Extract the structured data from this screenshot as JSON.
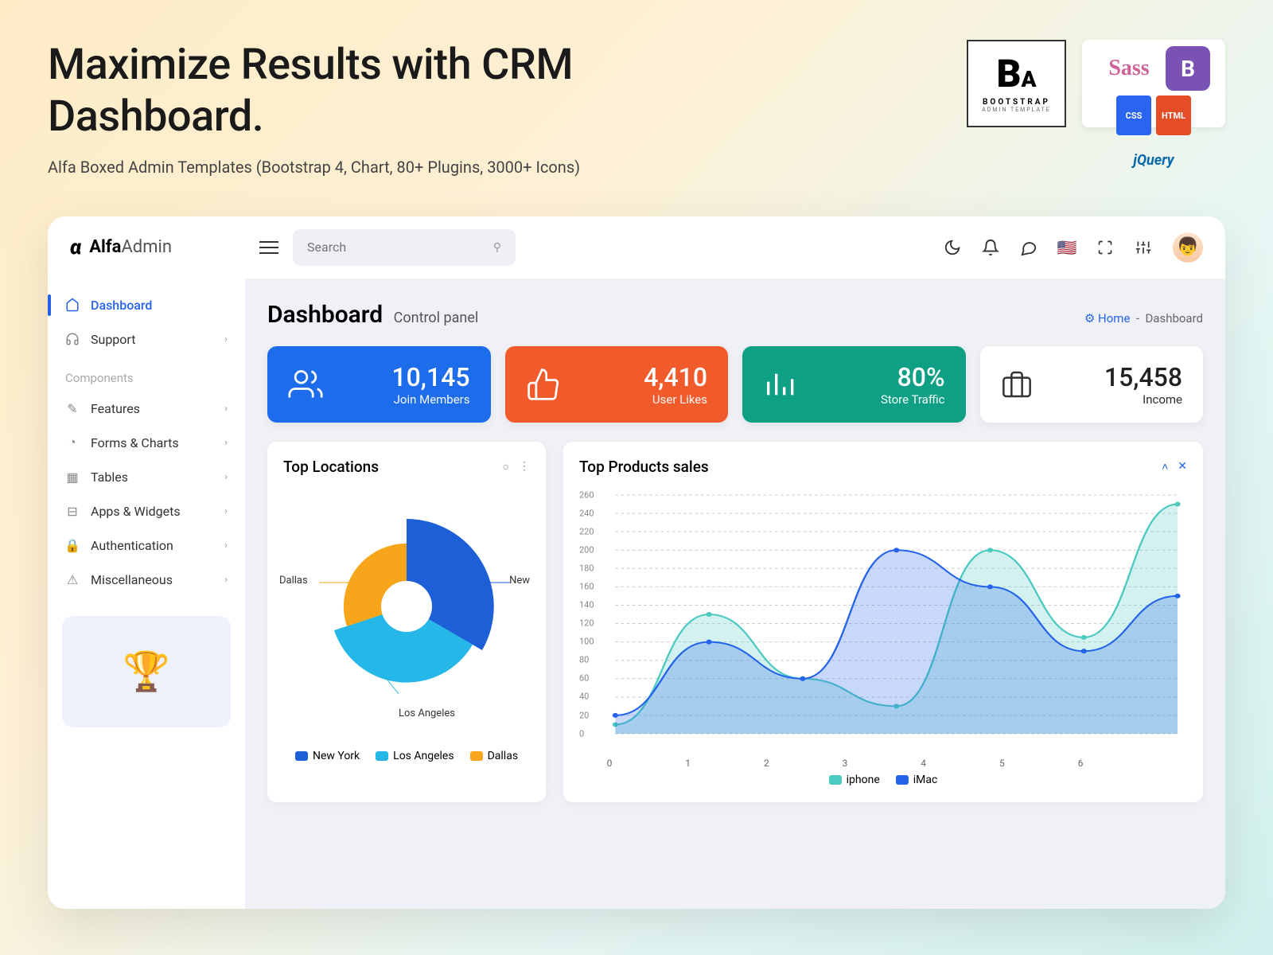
{
  "hero": {
    "title_l1": "Maximize Results with CRM",
    "title_l2": "Dashboard.",
    "subtitle": "Alfa Boxed Admin Templates (Bootstrap 4, Chart, 80+ Plugins, 3000+ Icons)",
    "bootstrap_label": "BOOTSTRAP",
    "bootstrap_sub": "ADMIN TEMPLATE",
    "badges": {
      "sass": "Sass",
      "css3": "CSS",
      "html5": "HTML",
      "bs": "B",
      "jq": "jQuery"
    }
  },
  "app": {
    "logo": {
      "bold": "Alfa",
      "light": "Admin"
    },
    "search_placeholder": "Search"
  },
  "sidebar": {
    "items": [
      {
        "icon": "home",
        "label": "Dashboard",
        "active": true,
        "expand": false
      },
      {
        "icon": "support",
        "label": "Support",
        "expand": true
      }
    ],
    "section": "Components",
    "comp": [
      {
        "icon": "features",
        "label": "Features"
      },
      {
        "icon": "forms",
        "label": "Forms & Charts"
      },
      {
        "icon": "tables",
        "label": "Tables"
      },
      {
        "icon": "apps",
        "label": "Apps & Widgets"
      },
      {
        "icon": "auth",
        "label": "Authentication"
      },
      {
        "icon": "misc",
        "label": "Miscellaneous"
      }
    ]
  },
  "page": {
    "title": "Dashboard",
    "subtitle": "Control panel",
    "crumb_home": "Home",
    "crumb_cur": "Dashboard"
  },
  "stats": [
    {
      "icon": "users",
      "value": "10,145",
      "label": "Join Members",
      "cls": "s-blue"
    },
    {
      "icon": "like",
      "value": "4,410",
      "label": "User Likes",
      "cls": "s-orange"
    },
    {
      "icon": "traffic",
      "value": "80%",
      "label": "Store Traffic",
      "cls": "s-teal"
    },
    {
      "icon": "income",
      "value": "15,458",
      "label": "Income",
      "cls": "s-white"
    }
  ],
  "panels": {
    "locations": {
      "title": "Top Locations",
      "labels": {
        "new": "New",
        "la": "Los Angeles",
        "dallas": "Dallas"
      },
      "legend": [
        {
          "name": "New York",
          "color": "#1d5fd6"
        },
        {
          "name": "Los Angeles",
          "color": "#25b7e8"
        },
        {
          "name": "Dallas",
          "color": "#f7a61b"
        }
      ]
    },
    "products": {
      "title": "Top Products sales",
      "legend": [
        {
          "name": "iphone",
          "color": "#4cc9c0"
        },
        {
          "name": "iMac",
          "color": "#2563eb"
        }
      ]
    }
  },
  "chart_data": [
    {
      "type": "pie",
      "title": "Top Locations",
      "series": [
        {
          "name": "New York",
          "value": 45
        },
        {
          "name": "Los Angeles",
          "value": 35
        },
        {
          "name": "Dallas",
          "value": 20
        }
      ]
    },
    {
      "type": "area",
      "title": "Top Products sales",
      "x": [
        0,
        1,
        2,
        3,
        4,
        5,
        6
      ],
      "xlabel": "",
      "ylabel": "",
      "ylim": [
        0,
        260
      ],
      "yticks": [
        0,
        20,
        40,
        60,
        80,
        100,
        120,
        140,
        160,
        180,
        200,
        220,
        240,
        260
      ],
      "series": [
        {
          "name": "iphone",
          "color": "#4cc9c0",
          "values": [
            10,
            130,
            60,
            30,
            200,
            105,
            250
          ]
        },
        {
          "name": "iMac",
          "color": "#2563eb",
          "values": [
            20,
            100,
            60,
            200,
            160,
            90,
            150
          ]
        }
      ]
    }
  ]
}
